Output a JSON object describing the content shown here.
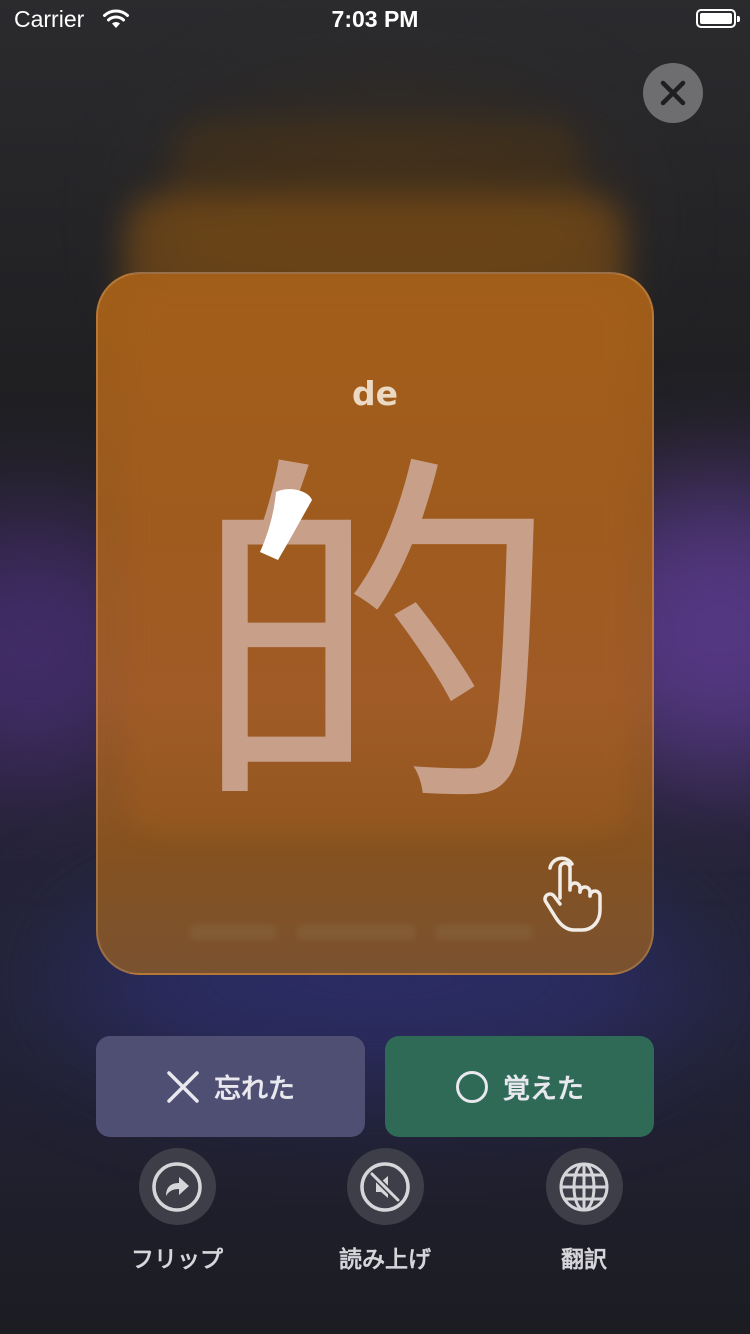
{
  "status_bar": {
    "carrier": "Carrier",
    "time": "7:03 PM"
  },
  "card": {
    "pinyin": "de",
    "hanzi": "的"
  },
  "actions": {
    "forgot_label": "忘れた",
    "remembered_label": "覚えた"
  },
  "toolbar": {
    "flip_label": "フリップ",
    "read_aloud_label": "読み上げ",
    "translate_label": "翻訳"
  },
  "colors": {
    "card": "#a15e19",
    "forgot_button": "#4f4f73",
    "remembered_button": "#2f6a57",
    "tool_circle": "#3e3e48"
  }
}
